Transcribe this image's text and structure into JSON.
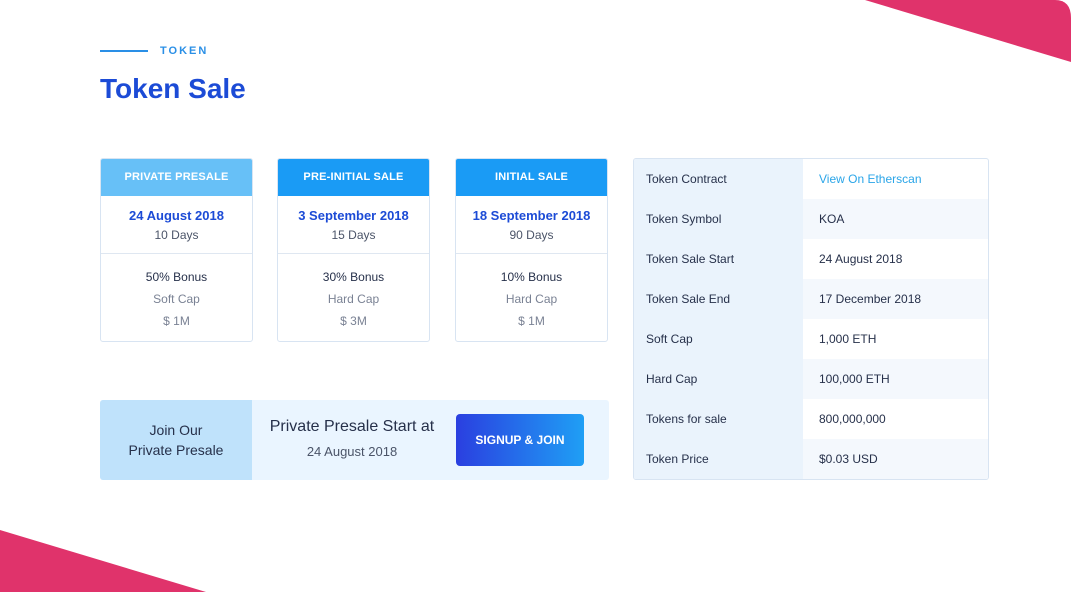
{
  "colors": {
    "accent_pink": "#e0336b",
    "primary_blue": "#1c4bd6",
    "light_blue": "#67c0f7",
    "bright_blue": "#1a9bf5",
    "link_blue": "#2aa5e8"
  },
  "header": {
    "eyebrow": "TOKEN",
    "title": "Token Sale"
  },
  "cards": [
    {
      "heading": "PRIVATE PRESALE",
      "date": "24 August 2018",
      "days": "10 Days",
      "bonus": "50% Bonus",
      "cap_label": "Soft Cap",
      "amount": "$ 1M",
      "head_color": "#67c0f7"
    },
    {
      "heading": "PRE-INITIAL SALE",
      "date": "3 September 2018",
      "days": "15 Days",
      "bonus": "30% Bonus",
      "cap_label": "Hard Cap",
      "amount": "$ 3M",
      "head_color": "#1a9bf5"
    },
    {
      "heading": "INITIAL SALE",
      "date": "18 September 2018",
      "days": "90 Days",
      "bonus": "10% Bonus",
      "cap_label": "Hard Cap",
      "amount": "$ 1M",
      "head_color": "#1a9bf5"
    }
  ],
  "join": {
    "left_line1": "Join Our",
    "left_line2": "Private Presale",
    "title": "Private Presale Start at",
    "date": "24 August 2018",
    "button_label": "SIGNUP & JOIN"
  },
  "info": [
    {
      "label": "Token Contract",
      "value": "View On Etherscan"
    },
    {
      "label": "Token Symbol",
      "value": "KOA"
    },
    {
      "label": "Token Sale Start",
      "value": "24 August 2018"
    },
    {
      "label": "Token Sale End",
      "value": "17 December 2018"
    },
    {
      "label": "Soft Cap",
      "value": "1,000 ETH"
    },
    {
      "label": "Hard Cap",
      "value": "100,000 ETH"
    },
    {
      "label": "Tokens for sale",
      "value": "800,000,000"
    },
    {
      "label": "Token Price",
      "value": "$0.03 USD"
    }
  ]
}
